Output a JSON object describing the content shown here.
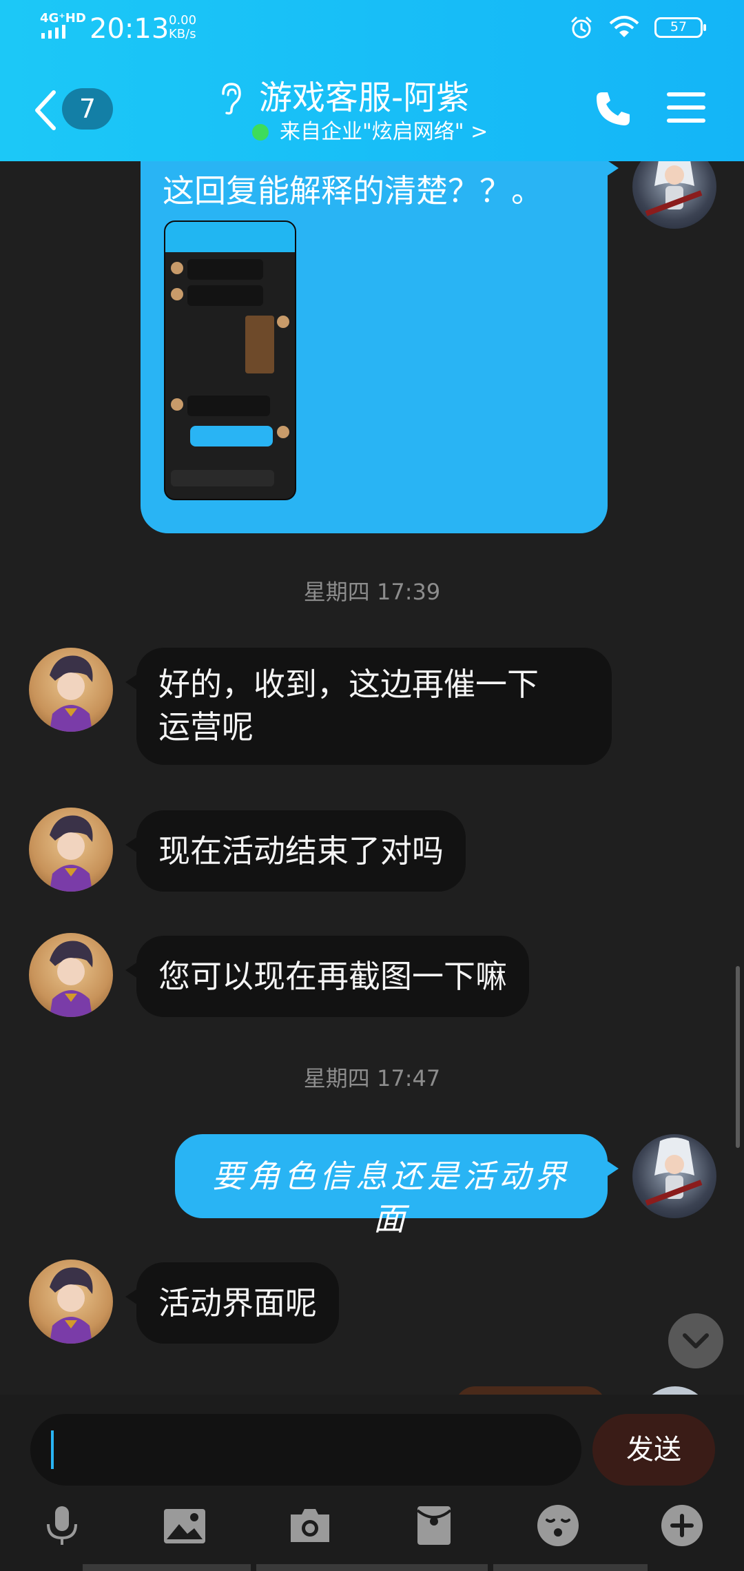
{
  "status_bar": {
    "network": "4G⁺HD",
    "time": "20:13",
    "speed_value": "0.00",
    "speed_unit": "KB/s",
    "battery": "57"
  },
  "header": {
    "unread_count": "7",
    "title": "游戏客服-阿紫",
    "subtitle": "来自企业\"炫启网络\" >",
    "icons": [
      "back-chevron-icon",
      "ear-icon",
      "phone-icon",
      "menu-icon"
    ]
  },
  "messages": [
    {
      "sender": "user",
      "type": "text_with_image",
      "text": "这回复能解释的清楚？？。"
    },
    {
      "type": "timestamp",
      "text": "星期四 17:39"
    },
    {
      "sender": "agent",
      "type": "text",
      "lines": [
        "好的，收到，这边再催一下",
        "运营呢"
      ]
    },
    {
      "sender": "agent",
      "type": "text",
      "text": "现在活动结束了对吗"
    },
    {
      "sender": "agent",
      "type": "text",
      "text": "您可以现在再截图一下嘛"
    },
    {
      "type": "timestamp",
      "text": "星期四 17:47"
    },
    {
      "sender": "user",
      "type": "text",
      "text": "要角色信息还是活动界面"
    },
    {
      "sender": "agent",
      "type": "text",
      "text": "活动界面呢"
    }
  ],
  "input": {
    "value": "",
    "send_label": "发送"
  },
  "toolbar": [
    "microphone-icon",
    "image-icon",
    "camera-icon",
    "red-packet-icon",
    "emoji-icon",
    "plus-icon"
  ],
  "colors": {
    "header_bg": "#1cc8f7",
    "user_bubble": "#29b4f4",
    "agent_bubble": "#121212",
    "chat_bg": "#1f1f1f",
    "send_button": "#3a1c17",
    "online_dot": "#3ddc5b"
  }
}
